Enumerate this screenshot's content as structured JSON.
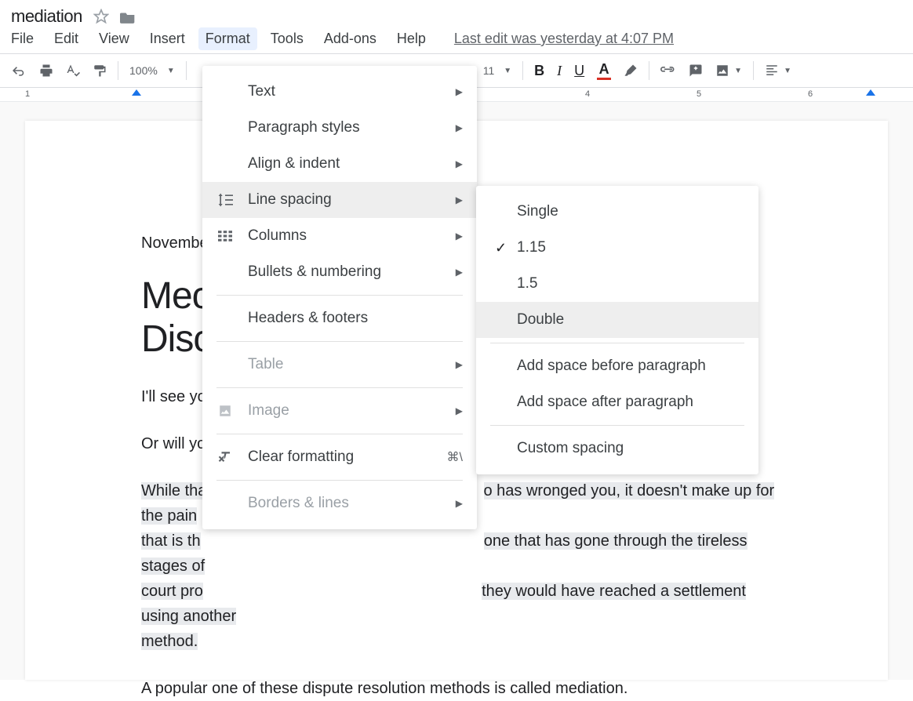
{
  "title": "mediation",
  "menubar": {
    "file": "File",
    "edit": "Edit",
    "view": "View",
    "insert": "Insert",
    "format": "Format",
    "tools": "Tools",
    "addons": "Add-ons",
    "help": "Help"
  },
  "last_edit": "Last edit was yesterday at 4:07 PM",
  "toolbar": {
    "zoom": "100%",
    "font_size": "11"
  },
  "ruler": {
    "t1": "1",
    "t4": "4",
    "t5": "5",
    "t6": "6"
  },
  "document": {
    "date": "November",
    "heading_line1": "Mec",
    "heading_line2": "Disc",
    "p1": "I'll see yo",
    "p2": "Or will yo",
    "p3_pre": "While tha",
    "p3_post": "o has wronged you, it doesn't make up for the pain",
    "p4_pre": "that is th",
    "p4_post": "one that has gone through the tireless stages of",
    "p5_pre": "court pro",
    "p5_post": "they would have reached a settlement using another",
    "p6": "method.",
    "p7": "A popular one of these dispute resolution methods is called mediation."
  },
  "format_menu": {
    "text": "Text",
    "paragraph_styles": "Paragraph styles",
    "align_indent": "Align & indent",
    "line_spacing": "Line spacing",
    "columns": "Columns",
    "bullets_numbering": "Bullets & numbering",
    "headers_footers": "Headers & footers",
    "table": "Table",
    "image": "Image",
    "clear_formatting": "Clear formatting",
    "clear_shortcut": "⌘\\",
    "borders_lines": "Borders & lines"
  },
  "spacing_menu": {
    "single": "Single",
    "v115": "1.15",
    "v15": "1.5",
    "double": "Double",
    "before": "Add space before paragraph",
    "after": "Add space after paragraph",
    "custom": "Custom spacing"
  }
}
